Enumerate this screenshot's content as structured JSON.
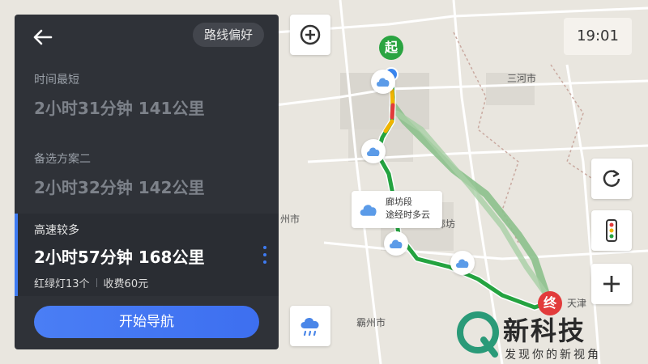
{
  "panel": {
    "preference_button": "路线偏好",
    "routes": [
      {
        "label": "时间最短",
        "summary": "2小时31分钟  141公里"
      },
      {
        "label": "备选方案二",
        "summary": "2小时32分钟  142公里"
      },
      {
        "label": "高速较多",
        "summary": "2小时57分钟  168公里",
        "traffic_lights": "红绿灯13个",
        "toll": "收费60元"
      }
    ],
    "start_navigation": "开始导航"
  },
  "status": {
    "time": "19:01"
  },
  "map": {
    "start_marker": "起",
    "end_marker": "终",
    "labels": {
      "sanhe": "三河市",
      "langfang": "廊坊",
      "bazhou": "霸州市",
      "tianjin": "天津",
      "left_city": "州市"
    },
    "weather_tip": {
      "line1": "廊坊段",
      "line2": "途经时多云"
    }
  },
  "logo": {
    "title": "新科技",
    "subtitle": "发现你的新视角"
  },
  "colors": {
    "accent": "#3e7bf2",
    "panel_bg": "#2f3238",
    "route_green": "#24a340",
    "alt_route": "#8cc08c",
    "start_green": "#2aa441",
    "end_red": "#e23b3b",
    "traffic_yellow": "#f0b400",
    "traffic_red": "#e23b3b"
  },
  "icons": {
    "back": "back-arrow-icon",
    "zoom_in": "plus-circle-icon",
    "refresh": "refresh-icon",
    "traffic": "traffic-light-icon",
    "zoom": "plus-icon",
    "weather": "rain-cloud-icon",
    "more": "more-vertical-icon"
  }
}
